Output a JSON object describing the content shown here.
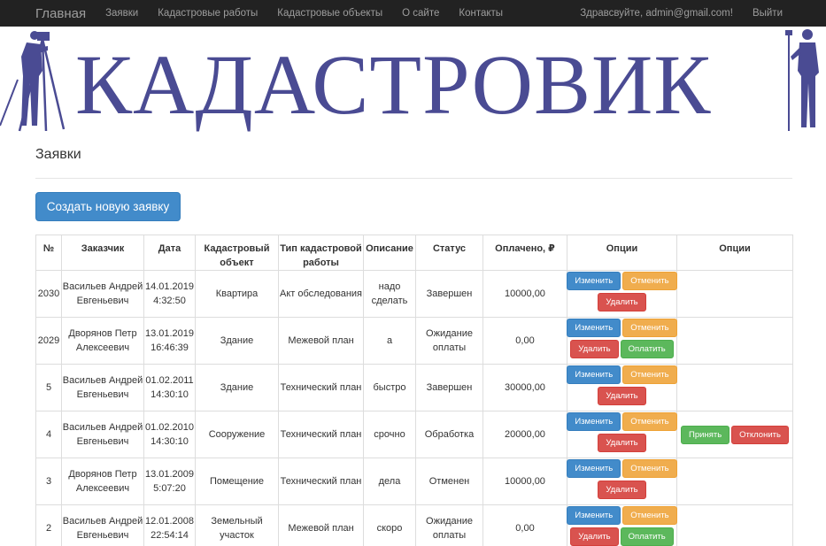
{
  "navbar": {
    "brand": "Главная",
    "links": [
      "Заявки",
      "Кадастровые работы",
      "Кадастровые объекты",
      "О сайте",
      "Контакты"
    ],
    "greeting": "Здравсвуйте, admin@gmail.com!",
    "logout": "Выйти"
  },
  "banner": {
    "title": "КАДАСТРОВИК",
    "color": "#4a4b93"
  },
  "page": {
    "title": "Заявки",
    "create_button": "Создать новую заявку"
  },
  "table": {
    "headers": [
      "№",
      "Заказчик",
      "Дата",
      "Кадастровый объект",
      "Тип кадастровой работы",
      "Описание",
      "Статус",
      "Оплачено, ₽",
      "Опции",
      "Опции"
    ],
    "buttons": {
      "edit": "Изменить",
      "cancel": "Отменить",
      "delete": "Удалить",
      "pay": "Оплатить",
      "accept": "Принять",
      "reject": "Отклонить"
    },
    "rows": [
      {
        "id": "2030",
        "customer": "Васильев Андрей Евгеньевич",
        "date": "14.01.2019",
        "time": "4:32:50",
        "object": "Квартира",
        "work": "Акт обследования",
        "desc": "надо сделать",
        "status": "Завершен",
        "paid": "10000,00",
        "pay": false,
        "admin": false
      },
      {
        "id": "2029",
        "customer": "Дворянов Петр Алексеевич",
        "date": "13.01.2019",
        "time": "16:46:39",
        "object": "Здание",
        "work": "Межевой план",
        "desc": "а",
        "status": "Ожидание оплаты",
        "paid": "0,00",
        "pay": true,
        "admin": false
      },
      {
        "id": "5",
        "customer": "Васильев Андрей Евгеньевич",
        "date": "01.02.2011",
        "time": "14:30:10",
        "object": "Здание",
        "work": "Технический план",
        "desc": "быстро",
        "status": "Завершен",
        "paid": "30000,00",
        "pay": false,
        "admin": false
      },
      {
        "id": "4",
        "customer": "Васильев Андрей Евгеньевич",
        "date": "01.02.2010",
        "time": "14:30:10",
        "object": "Сооружение",
        "work": "Технический план",
        "desc": "срочно",
        "status": "Обработка",
        "paid": "20000,00",
        "pay": false,
        "admin": true
      },
      {
        "id": "3",
        "customer": "Дворянов Петр Алексеевич",
        "date": "13.01.2009",
        "time": "5:07:20",
        "object": "Помещение",
        "work": "Технический план",
        "desc": "дела",
        "status": "Отменен",
        "paid": "10000,00",
        "pay": false,
        "admin": false
      },
      {
        "id": "2",
        "customer": "Васильев Андрей Евгеньевич",
        "date": "12.01.2008",
        "time": "22:54:14",
        "object": "Земельный участок",
        "work": "Межевой план",
        "desc": "скоро",
        "status": "Ожидание оплаты",
        "paid": "0,00",
        "pay": true,
        "admin": false
      }
    ]
  }
}
